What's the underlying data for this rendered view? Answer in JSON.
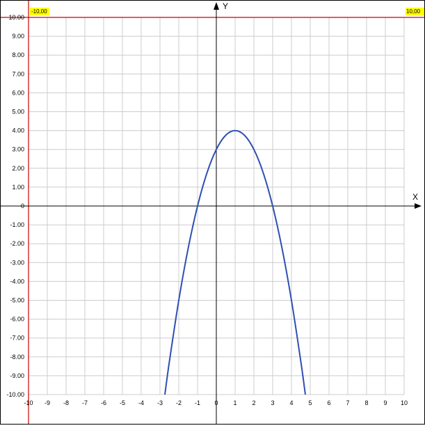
{
  "colors": {
    "background": "#ffffff",
    "grid": "#cccccc",
    "axis": "#000000",
    "curve": "#2e4fb3",
    "limit_line": "#cc0000",
    "limit_label_bg": "#ffff00"
  },
  "chart_data": {
    "type": "line",
    "title": "",
    "xlabel": "X",
    "ylabel": "Y",
    "xlim": [
      -10,
      10
    ],
    "ylim": [
      -10,
      10
    ],
    "grid": true,
    "x_ticks": [
      -10,
      -9,
      -8,
      -7,
      -6,
      -5,
      -4,
      -3,
      -2,
      -1,
      0,
      1,
      2,
      3,
      4,
      5,
      6,
      7,
      8,
      9,
      10
    ],
    "x_tick_labels": [
      "-10",
      "-9",
      "-8",
      "-7",
      "-6",
      "-5",
      "-4",
      "-3",
      "-2",
      "-1",
      "0",
      "1",
      "2",
      "3",
      "4",
      "5",
      "6",
      "7",
      "8",
      "9",
      "10"
    ],
    "y_ticks": [
      10,
      9,
      8,
      7,
      6,
      5,
      4,
      3,
      2,
      1,
      0,
      -1,
      -2,
      -3,
      -4,
      -5,
      -6,
      -7,
      -8,
      -9,
      -10
    ],
    "y_tick_labels": [
      "10.00",
      "9.00",
      "8.00",
      "7.00",
      "6.00",
      "5.00",
      "4.00",
      "3.00",
      "2.00",
      "1.00",
      "0",
      "-1.00",
      "-2.00",
      "-3.00",
      "-4.00",
      "-5.00",
      "-6.00",
      "-7.00",
      "-8.00",
      "-9.00",
      "-10.00"
    ],
    "limit_labels": {
      "left": "-10,00",
      "right": "10,00"
    },
    "series": [
      {
        "x": [
          -2.74,
          -2.5,
          -2.0,
          -1.5,
          -1.0,
          -0.5,
          0.0,
          0.5,
          1.0,
          1.5,
          2.0,
          2.5,
          3.0,
          3.5,
          4.0,
          4.5,
          4.74
        ],
        "y": [
          -10.0,
          -8.25,
          -5.0,
          -2.25,
          0.0,
          1.75,
          3.0,
          3.75,
          4.0,
          3.75,
          3.0,
          1.75,
          0.0,
          -2.25,
          -5.0,
          -8.25,
          -10.0
        ]
      }
    ]
  }
}
